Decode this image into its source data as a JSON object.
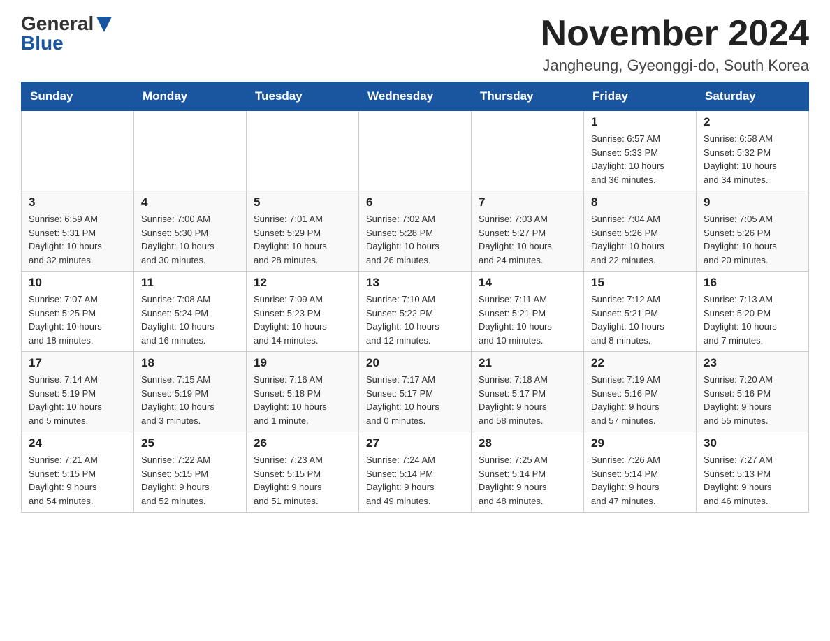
{
  "header": {
    "logo_general": "General",
    "logo_blue": "Blue",
    "title": "November 2024",
    "location": "Jangheung, Gyeonggi-do, South Korea"
  },
  "weekdays": [
    "Sunday",
    "Monday",
    "Tuesday",
    "Wednesday",
    "Thursday",
    "Friday",
    "Saturday"
  ],
  "weeks": [
    [
      {
        "day": "",
        "info": ""
      },
      {
        "day": "",
        "info": ""
      },
      {
        "day": "",
        "info": ""
      },
      {
        "day": "",
        "info": ""
      },
      {
        "day": "",
        "info": ""
      },
      {
        "day": "1",
        "info": "Sunrise: 6:57 AM\nSunset: 5:33 PM\nDaylight: 10 hours\nand 36 minutes."
      },
      {
        "day": "2",
        "info": "Sunrise: 6:58 AM\nSunset: 5:32 PM\nDaylight: 10 hours\nand 34 minutes."
      }
    ],
    [
      {
        "day": "3",
        "info": "Sunrise: 6:59 AM\nSunset: 5:31 PM\nDaylight: 10 hours\nand 32 minutes."
      },
      {
        "day": "4",
        "info": "Sunrise: 7:00 AM\nSunset: 5:30 PM\nDaylight: 10 hours\nand 30 minutes."
      },
      {
        "day": "5",
        "info": "Sunrise: 7:01 AM\nSunset: 5:29 PM\nDaylight: 10 hours\nand 28 minutes."
      },
      {
        "day": "6",
        "info": "Sunrise: 7:02 AM\nSunset: 5:28 PM\nDaylight: 10 hours\nand 26 minutes."
      },
      {
        "day": "7",
        "info": "Sunrise: 7:03 AM\nSunset: 5:27 PM\nDaylight: 10 hours\nand 24 minutes."
      },
      {
        "day": "8",
        "info": "Sunrise: 7:04 AM\nSunset: 5:26 PM\nDaylight: 10 hours\nand 22 minutes."
      },
      {
        "day": "9",
        "info": "Sunrise: 7:05 AM\nSunset: 5:26 PM\nDaylight: 10 hours\nand 20 minutes."
      }
    ],
    [
      {
        "day": "10",
        "info": "Sunrise: 7:07 AM\nSunset: 5:25 PM\nDaylight: 10 hours\nand 18 minutes."
      },
      {
        "day": "11",
        "info": "Sunrise: 7:08 AM\nSunset: 5:24 PM\nDaylight: 10 hours\nand 16 minutes."
      },
      {
        "day": "12",
        "info": "Sunrise: 7:09 AM\nSunset: 5:23 PM\nDaylight: 10 hours\nand 14 minutes."
      },
      {
        "day": "13",
        "info": "Sunrise: 7:10 AM\nSunset: 5:22 PM\nDaylight: 10 hours\nand 12 minutes."
      },
      {
        "day": "14",
        "info": "Sunrise: 7:11 AM\nSunset: 5:21 PM\nDaylight: 10 hours\nand 10 minutes."
      },
      {
        "day": "15",
        "info": "Sunrise: 7:12 AM\nSunset: 5:21 PM\nDaylight: 10 hours\nand 8 minutes."
      },
      {
        "day": "16",
        "info": "Sunrise: 7:13 AM\nSunset: 5:20 PM\nDaylight: 10 hours\nand 7 minutes."
      }
    ],
    [
      {
        "day": "17",
        "info": "Sunrise: 7:14 AM\nSunset: 5:19 PM\nDaylight: 10 hours\nand 5 minutes."
      },
      {
        "day": "18",
        "info": "Sunrise: 7:15 AM\nSunset: 5:19 PM\nDaylight: 10 hours\nand 3 minutes."
      },
      {
        "day": "19",
        "info": "Sunrise: 7:16 AM\nSunset: 5:18 PM\nDaylight: 10 hours\nand 1 minute."
      },
      {
        "day": "20",
        "info": "Sunrise: 7:17 AM\nSunset: 5:17 PM\nDaylight: 10 hours\nand 0 minutes."
      },
      {
        "day": "21",
        "info": "Sunrise: 7:18 AM\nSunset: 5:17 PM\nDaylight: 9 hours\nand 58 minutes."
      },
      {
        "day": "22",
        "info": "Sunrise: 7:19 AM\nSunset: 5:16 PM\nDaylight: 9 hours\nand 57 minutes."
      },
      {
        "day": "23",
        "info": "Sunrise: 7:20 AM\nSunset: 5:16 PM\nDaylight: 9 hours\nand 55 minutes."
      }
    ],
    [
      {
        "day": "24",
        "info": "Sunrise: 7:21 AM\nSunset: 5:15 PM\nDaylight: 9 hours\nand 54 minutes."
      },
      {
        "day": "25",
        "info": "Sunrise: 7:22 AM\nSunset: 5:15 PM\nDaylight: 9 hours\nand 52 minutes."
      },
      {
        "day": "26",
        "info": "Sunrise: 7:23 AM\nSunset: 5:15 PM\nDaylight: 9 hours\nand 51 minutes."
      },
      {
        "day": "27",
        "info": "Sunrise: 7:24 AM\nSunset: 5:14 PM\nDaylight: 9 hours\nand 49 minutes."
      },
      {
        "day": "28",
        "info": "Sunrise: 7:25 AM\nSunset: 5:14 PM\nDaylight: 9 hours\nand 48 minutes."
      },
      {
        "day": "29",
        "info": "Sunrise: 7:26 AM\nSunset: 5:14 PM\nDaylight: 9 hours\nand 47 minutes."
      },
      {
        "day": "30",
        "info": "Sunrise: 7:27 AM\nSunset: 5:13 PM\nDaylight: 9 hours\nand 46 minutes."
      }
    ]
  ]
}
